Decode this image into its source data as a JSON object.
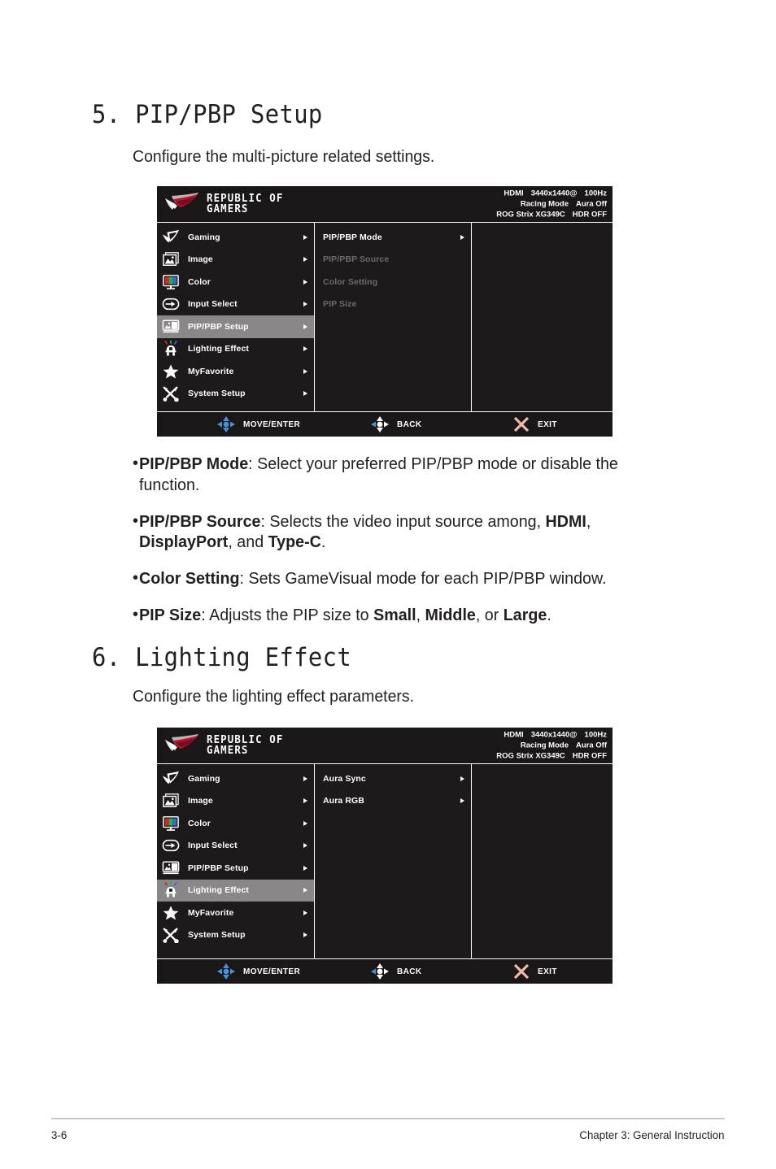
{
  "sections": [
    {
      "title": "5. PIP/PBP Setup",
      "intro": "Configure the multi-picture related settings."
    },
    {
      "title": "6. Lighting Effect",
      "intro": "Configure the lighting effect parameters."
    }
  ],
  "osd": {
    "brand": {
      "line1": "REPUBLIC OF",
      "line2": "GAMERS"
    },
    "status": {
      "input": "HDMI",
      "resolution": "3440x1440@",
      "refresh": "100Hz",
      "mode": "Racing Mode",
      "aura": "Aura Off",
      "model": "ROG Strix XG349C",
      "hdr": "HDR OFF"
    },
    "nav_items": [
      {
        "label": "Gaming",
        "icon": "rog-eye-icon"
      },
      {
        "label": "Image",
        "icon": "image-icon"
      },
      {
        "label": "Color",
        "icon": "color-monitor-icon"
      },
      {
        "label": "Input Select",
        "icon": "input-select-icon"
      },
      {
        "label": "PIP/PBP Setup",
        "icon": "pip-pbp-icon"
      },
      {
        "label": "Lighting Effect",
        "icon": "lighting-effect-icon"
      },
      {
        "label": "MyFavorite",
        "icon": "star-icon"
      },
      {
        "label": "System Setup",
        "icon": "tools-icon"
      }
    ],
    "footer": {
      "move": "MOVE/ENTER",
      "back": "BACK",
      "exit": "EXIT"
    },
    "menu_1": {
      "active_index": 4,
      "submenu": [
        {
          "label": "PIP/PBP Mode",
          "state": "enabled"
        },
        {
          "label": "PIP/PBP Source",
          "state": "disabled"
        },
        {
          "label": "Color Setting",
          "state": "disabled"
        },
        {
          "label": "PIP Size",
          "state": "disabled"
        }
      ]
    },
    "menu_2": {
      "active_index": 5,
      "submenu": [
        {
          "label": "Aura Sync",
          "state": "enabled"
        },
        {
          "label": "Aura RGB",
          "state": "enabled"
        }
      ]
    }
  },
  "bullets": [
    {
      "term": "PIP/PBP Mode",
      "rest": ": Select your preferred PIP/PBP mode or disable the function."
    },
    {
      "term": "PIP/PBP Source",
      "rest": ": Selects the video input source among, ",
      "bolds": [
        "HDMI",
        "DisplayPort",
        "Type-C"
      ],
      "tail": "."
    },
    {
      "term": "Color Setting",
      "rest": ": Sets GameVisual mode for each PIP/PBP window."
    },
    {
      "term": "PIP Size",
      "rest": ": Adjusts the PIP size to ",
      "bolds": [
        "Small",
        "Middle",
        "Large"
      ],
      "tail": "."
    }
  ],
  "page_footer": {
    "page_number": "3-6",
    "chapter": "Chapter 3: General Instruction"
  },
  "colors": {
    "osd_bg": "#1c1a1a",
    "osd_header_bg": "#1a1718",
    "highlight": "#8a8789",
    "disabled_text": "#6d6a6b",
    "dpad_blue": "#4a90d9",
    "exit_pink": "#f0b9a8",
    "rog_red": "#c8102e"
  }
}
